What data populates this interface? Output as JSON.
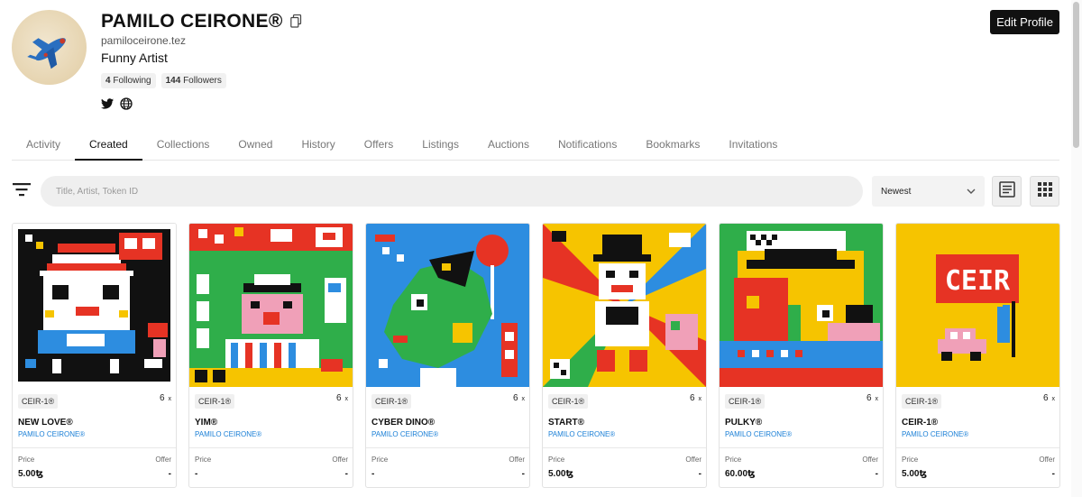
{
  "profile": {
    "name": "PAMILO CEIRONE®",
    "domain": "pamiloceirone.tez",
    "bio": "Funny Artist",
    "following_count": "4",
    "following_label": "Following",
    "followers_count": "144",
    "followers_label": "Followers",
    "edit_label": "Edit Profile"
  },
  "tabs": [
    "Activity",
    "Created",
    "Collections",
    "Owned",
    "History",
    "Offers",
    "Listings",
    "Auctions",
    "Notifications",
    "Bookmarks",
    "Invitations"
  ],
  "active_tab": "Created",
  "search": {
    "placeholder": "Title, Artist, Token ID"
  },
  "sort": {
    "selected": "Newest"
  },
  "cards": [
    {
      "collection": "CEIR-1®",
      "edition": "6",
      "edition_x": "x",
      "title": "NEW LOVE®",
      "artist": "PAMILO CEIRONE®",
      "price_label": "Price",
      "price": "5.00ꜩ",
      "offer_label": "Offer",
      "offer": "-"
    },
    {
      "collection": "CEIR-1®",
      "edition": "6",
      "edition_x": "x",
      "title": "YIM®",
      "artist": "PAMILO CEIRONE®",
      "price_label": "Price",
      "price": "-",
      "offer_label": "Offer",
      "offer": "-"
    },
    {
      "collection": "CEIR-1®",
      "edition": "6",
      "edition_x": "x",
      "title": "CYBER DINO®",
      "artist": "PAMILO CEIRONE®",
      "price_label": "Price",
      "price": "-",
      "offer_label": "Offer",
      "offer": "-"
    },
    {
      "collection": "CEIR-1®",
      "edition": "6",
      "edition_x": "x",
      "title": "START®",
      "artist": "PAMILO CEIRONE®",
      "price_label": "Price",
      "price": "5.00ꜩ",
      "offer_label": "Offer",
      "offer": "-"
    },
    {
      "collection": "CEIR-1®",
      "edition": "6",
      "edition_x": "x",
      "title": "PULKY®",
      "artist": "PAMILO CEIRONE®",
      "price_label": "Price",
      "price": "60.00ꜩ",
      "offer_label": "Offer",
      "offer": "-"
    },
    {
      "collection": "CEIR-1®",
      "edition": "6",
      "edition_x": "x",
      "title": "CEIR-1®",
      "artist": "PAMILO CEIRONE®",
      "price_label": "Price",
      "price": "5.00ꜩ",
      "offer_label": "Offer",
      "offer": "-"
    }
  ],
  "art": {
    "card6_sign_text": "CEIR"
  },
  "icons": {
    "copy": "copy-icon",
    "twitter": "twitter-icon",
    "globe": "globe-icon",
    "filter": "filter-icon",
    "chevron": "chevron-down-icon",
    "list_view": "list-view-icon",
    "grid_view": "grid-view-icon"
  },
  "colors": {
    "accent_link": "#1a7fd6",
    "button_dark": "#111111"
  }
}
